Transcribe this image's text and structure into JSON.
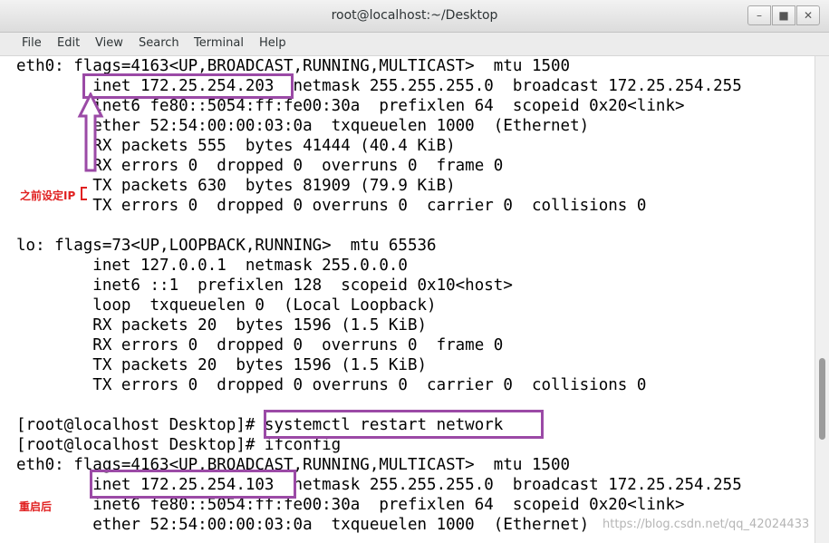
{
  "window": {
    "title": "root@localhost:~/Desktop",
    "minimize_glyph": "–",
    "maximize_glyph": "■",
    "close_glyph": "✕"
  },
  "menu": [
    "File",
    "Edit",
    "View",
    "Search",
    "Terminal",
    "Help"
  ],
  "terminal": {
    "lines": [
      "eth0: flags=4163<UP,BROADCAST,RUNNING,MULTICAST>  mtu 1500",
      "        inet 172.25.254.203  netmask 255.255.255.0  broadcast 172.25.254.255",
      "        inet6 fe80::5054:ff:fe00:30a  prefixlen 64  scopeid 0x20<link>",
      "        ether 52:54:00:00:03:0a  txqueuelen 1000  (Ethernet)",
      "        RX packets 555  bytes 41444 (40.4 KiB)",
      "        RX errors 0  dropped 0  overruns 0  frame 0",
      "        TX packets 630  bytes 81909 (79.9 KiB)",
      "        TX errors 0  dropped 0 overruns 0  carrier 0  collisions 0",
      "",
      "lo: flags=73<UP,LOOPBACK,RUNNING>  mtu 65536",
      "        inet 127.0.0.1  netmask 255.0.0.0",
      "        inet6 ::1  prefixlen 128  scopeid 0x10<host>",
      "        loop  txqueuelen 0  (Local Loopback)",
      "        RX packets 20  bytes 1596 (1.5 KiB)",
      "        RX errors 0  dropped 0  overruns 0  frame 0",
      "        TX packets 20  bytes 1596 (1.5 KiB)",
      "        TX errors 0  dropped 0 overruns 0  carrier 0  collisions 0",
      "",
      "[root@localhost Desktop]# systemctl restart network",
      "[root@localhost Desktop]# ifconfig",
      "eth0: flags=4163<UP,BROADCAST,RUNNING,MULTICAST>  mtu 1500",
      "        inet 172.25.254.103  netmask 255.255.255.0  broadcast 172.25.254.255",
      "        inet6 fe80::5054:ff:fe00:30a  prefixlen 64  scopeid 0x20<link>",
      "        ether 52:54:00:00:03:0a  txqueuelen 1000  (Ethernet)"
    ]
  },
  "annotations": {
    "previous_ip_label": "之前设定IP",
    "after_restart_label": "重启后",
    "highlight_color": "#9b4aa6",
    "label_color": "#e02020"
  },
  "watermark": "https://blog.csdn.net/qq_42024433"
}
